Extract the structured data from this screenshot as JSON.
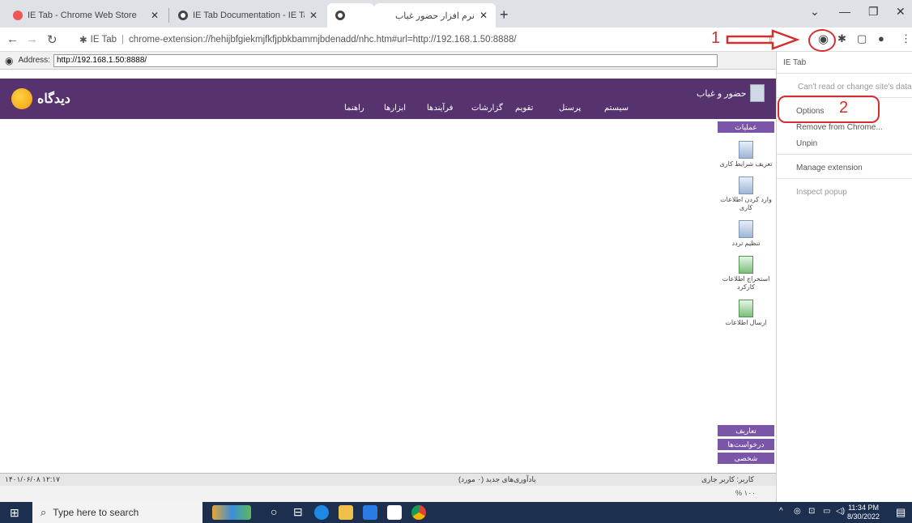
{
  "tabs": [
    {
      "title": "IE Tab - Chrome Web Store",
      "active": false
    },
    {
      "title": "IE Tab Documentation - IE Tab - I",
      "active": false
    },
    {
      "title": "",
      "active": true
    },
    {
      "title": "نرم افزار حضور غیاب",
      "active": false
    }
  ],
  "omnibox": {
    "site_label": "IE Tab",
    "url": "chrome-extension://hehijbfgiekmjfkfjpbkbammjbdenadd/nhc.htm#url=http://192.168.1.50:8888/"
  },
  "ie_address": {
    "label": "Address:",
    "value": "http://192.168.1.50:8888/"
  },
  "app": {
    "logo": "دیدگاه",
    "title": "حضور و غیاب",
    "menu": [
      "سیستم",
      "پرسنل",
      "تقویم",
      "گزارشات",
      "فرآیندها",
      "ابزارها",
      "راهنما"
    ]
  },
  "side_panel": {
    "header": "عملیات",
    "items": [
      "تعریف شرایط کاری",
      "وارد کردن اطلاعات کاری",
      "تنظیم تردد",
      "استخراج اطلاعات کارکرد",
      "ارسال اطلاعات"
    ],
    "footers": [
      "تعاریف",
      "درخواست‌ها",
      "شخصی"
    ]
  },
  "status": {
    "date": "۱۴۰۱/۰۶/۰۸ ۱۲:۱۷",
    "reminders": "یادآوری‌های جدید (۰ مورد)",
    "user": "کاربر: کاربر جاری",
    "zoom": "% ۱۰۰"
  },
  "popup": {
    "items": [
      {
        "label": "IE Tab",
        "dim": false
      },
      {
        "label": "Can't read or change site's data",
        "dim": true
      },
      {
        "label": "Options",
        "dim": false
      },
      {
        "label": "Remove from Chrome...",
        "dim": false
      },
      {
        "label": "Unpin",
        "dim": false
      },
      {
        "label": "Manage extension",
        "dim": false
      },
      {
        "label": "Inspect popup",
        "dim": true
      }
    ]
  },
  "annotations": {
    "step1": "1",
    "step2": "2"
  },
  "taskbar": {
    "search_placeholder": "Type here to search",
    "time": "11:34 PM",
    "date": "8/30/2022"
  },
  "colors": {
    "accent_purple": "#56336e",
    "annotation_red": "#d32f2f",
    "taskbar": "#1c2f4e"
  }
}
